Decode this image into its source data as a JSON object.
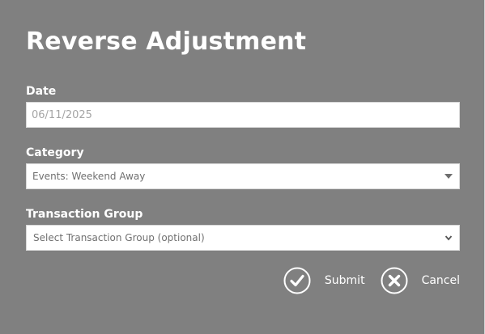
{
  "dialog": {
    "title": "Reverse Adjustment"
  },
  "date": {
    "label": "Date",
    "value": "06/11/2025"
  },
  "category": {
    "label": "Category",
    "selected": "Events: Weekend Away"
  },
  "transaction_group": {
    "label": "Transaction Group",
    "placeholder": "Select Transaction Group (optional)"
  },
  "actions": {
    "submit_label": "Submit",
    "cancel_label": "Cancel"
  },
  "icons": {
    "submit": "check-circle-icon",
    "cancel": "close-circle-icon",
    "category_dropdown": "caret-down-icon",
    "group_dropdown": "chevron-down-icon"
  },
  "colors": {
    "background": "#808080",
    "text": "#ffffff",
    "field_bg": "#ffffff",
    "placeholder_text": "#a5a5a5"
  }
}
